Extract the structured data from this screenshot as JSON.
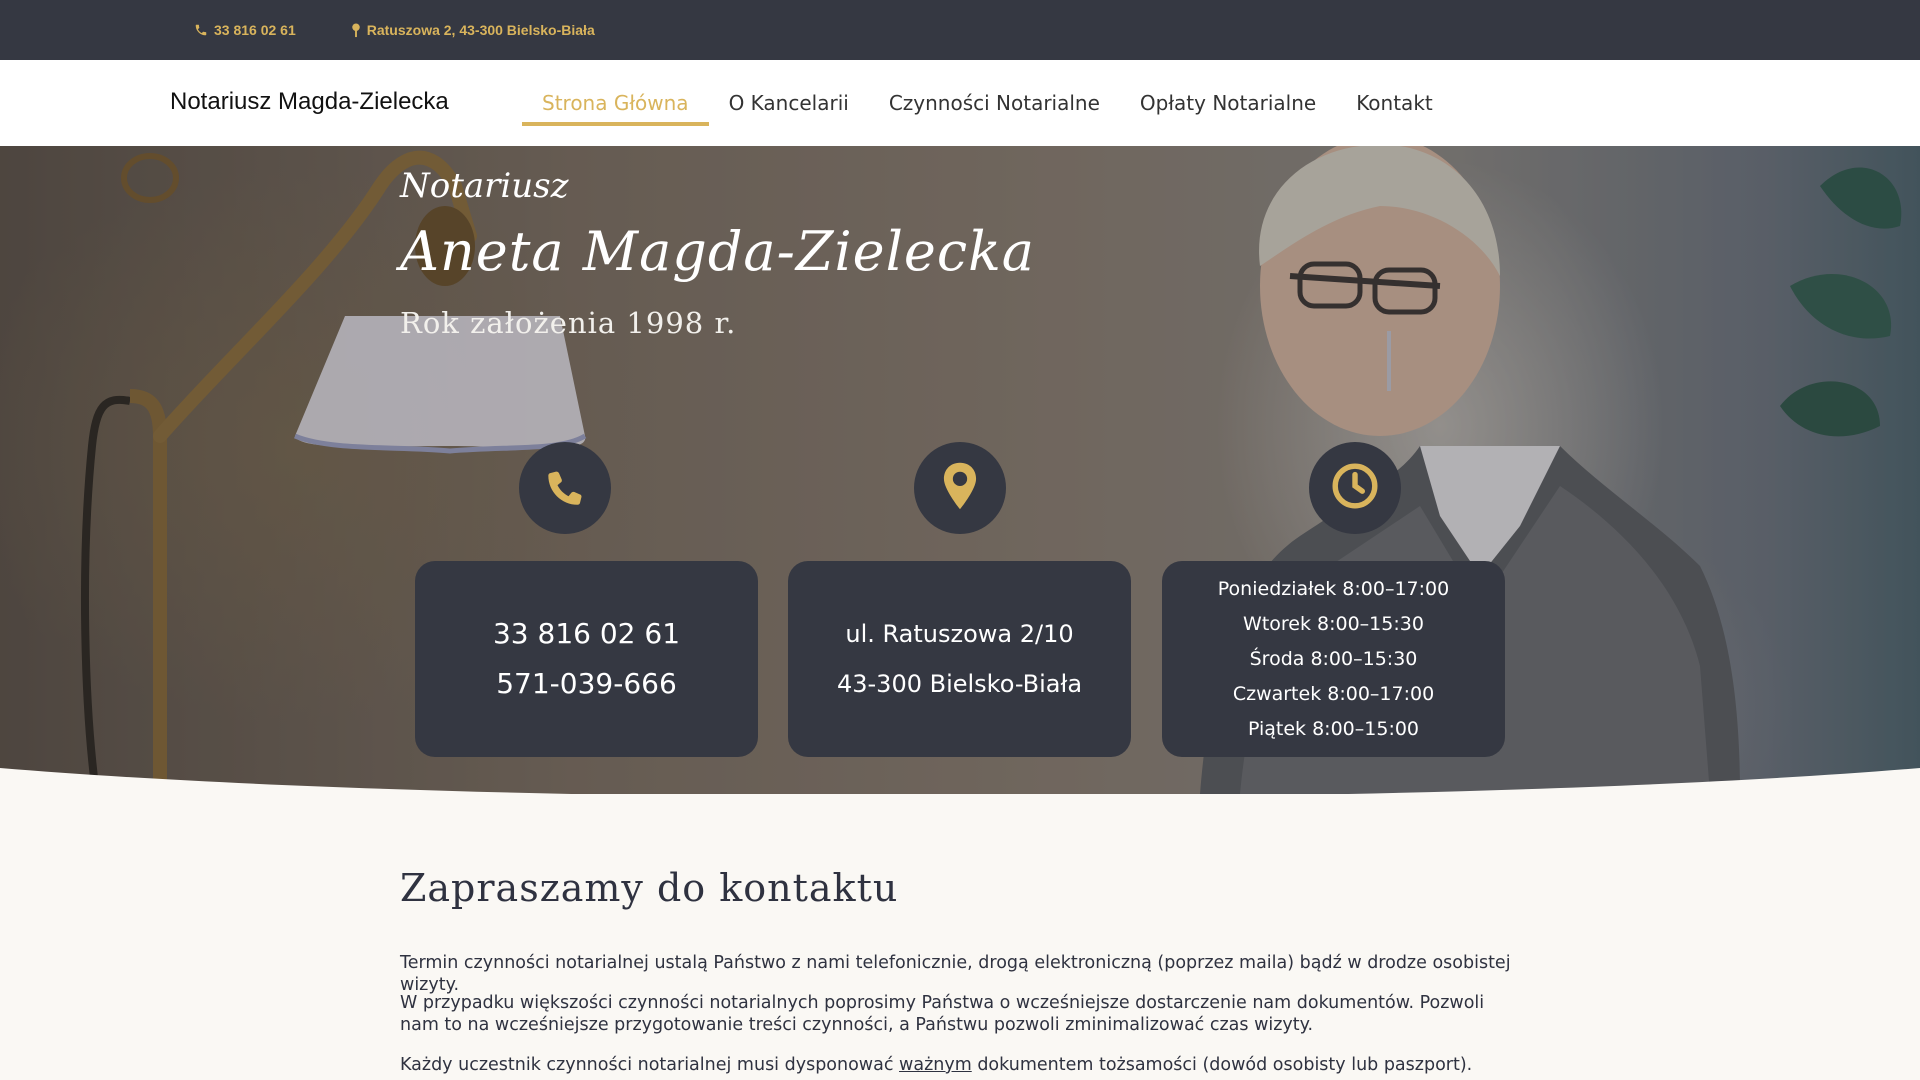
{
  "topbar": {
    "phone": "33 816 02 61",
    "address": "Ratuszowa 2, 43-300 Bielsko-Biała",
    "phone_icon": "phone-icon",
    "address_icon": "map-pin-icon"
  },
  "nav": {
    "brand": "Notariusz Magda-Zielecka",
    "items": [
      {
        "label": "Strona Główna",
        "active": true
      },
      {
        "label": "O Kancelarii"
      },
      {
        "label": "Czynności Notarialne"
      },
      {
        "label": "Opłaty Notarialne"
      },
      {
        "label": "Kontakt"
      }
    ]
  },
  "hero": {
    "subtitle": "Notariusz",
    "name": "Aneta Magda-Zielecka",
    "founded": "Rok założenia 1998 r.",
    "cards": {
      "phone": {
        "icon": "phone-icon",
        "line1": "33 816 02 61",
        "line2": "571-039-666"
      },
      "address": {
        "icon": "location-pin-icon",
        "line1": "ul. Ratuszowa 2/10",
        "line2": "43-300 Bielsko-Biała"
      },
      "hours": {
        "icon": "clock-icon",
        "lines": [
          "Poniedziałek 8:00–17:00",
          "Wtorek 8:00–15:30",
          "Środa 8:00–15:30",
          "Czwartek 8:00–17:00",
          "Piątek 8:00–15:00"
        ]
      }
    }
  },
  "contact": {
    "heading": "Zapraszamy do kontaktu",
    "p1": "Termin czynności notarialnej ustalą Państwo z nami telefonicznie, drogą elektroniczną (poprzez maila) bądź w drodze osobistej wizyty.",
    "p2": "W przypadku większości czynności notarialnych poprosimy Państwa o wcześniejsze dostarczenie nam dokumentów. Pozwoli nam to na wcześniejsze przygotowanie treści czynności, a Państwu pozwoli zminimalizować czas wizyty.",
    "p3_before": "Każdy uczestnik czynności notarialnej musi dysponować ",
    "p3_link": "ważnym",
    "p3_after": " dokumentem tożsamości (dowód osobisty lub paszport)."
  },
  "colors": {
    "accent": "#d9b45c",
    "dark": "#353842",
    "background": "#faf8f4"
  }
}
